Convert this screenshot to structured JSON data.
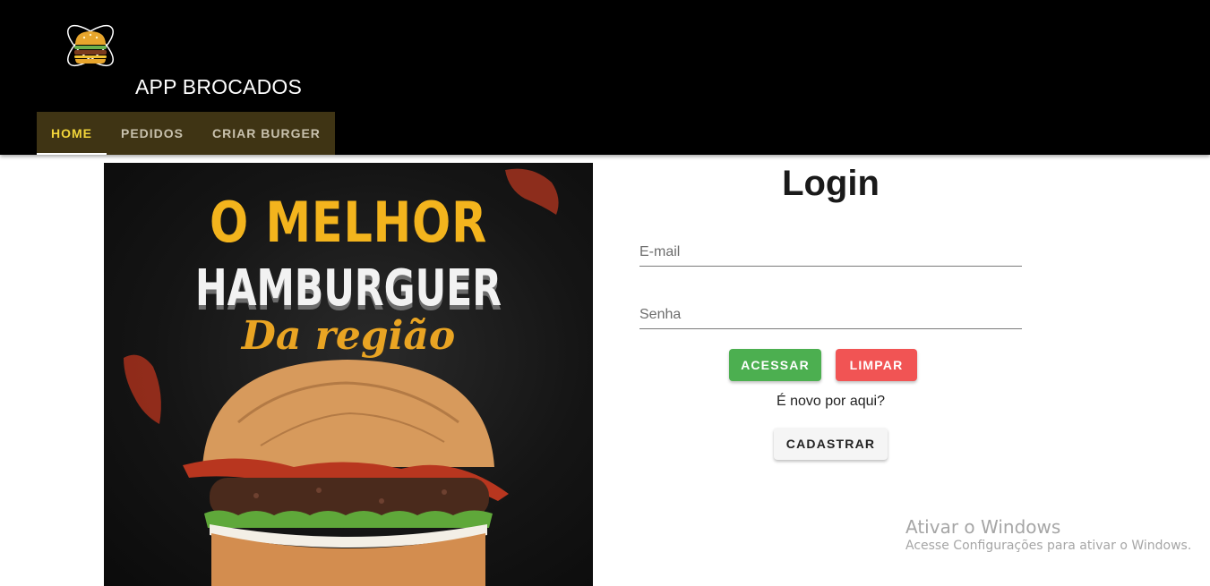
{
  "header": {
    "app_title": "APP BROCADOS",
    "logo_icon": "burger-atom-logo",
    "tabs": [
      {
        "label": "HOME",
        "active": true
      },
      {
        "label": "PEDIDOS",
        "active": false
      },
      {
        "label": "CRIAR BURGER",
        "active": false
      }
    ]
  },
  "hero": {
    "line1": "O MELHOR",
    "line2": "HAMBURGUER",
    "line3": "Da região"
  },
  "login": {
    "title": "Login",
    "email_placeholder": "E-mail",
    "password_placeholder": "Senha",
    "access_label": "ACESSAR",
    "clear_label": "LIMPAR",
    "new_here_text": "É novo por aqui?",
    "register_label": "CADASTRAR"
  },
  "watermark": {
    "title": "Ativar o Windows",
    "subtitle": "Acesse Configurações para ativar o Windows."
  },
  "colors": {
    "header_bg": "#000000",
    "tabs_bg": "#3f3414",
    "active_tab_text": "#f2d53a",
    "access_button": "#4caf50",
    "clear_button": "#f15454"
  }
}
